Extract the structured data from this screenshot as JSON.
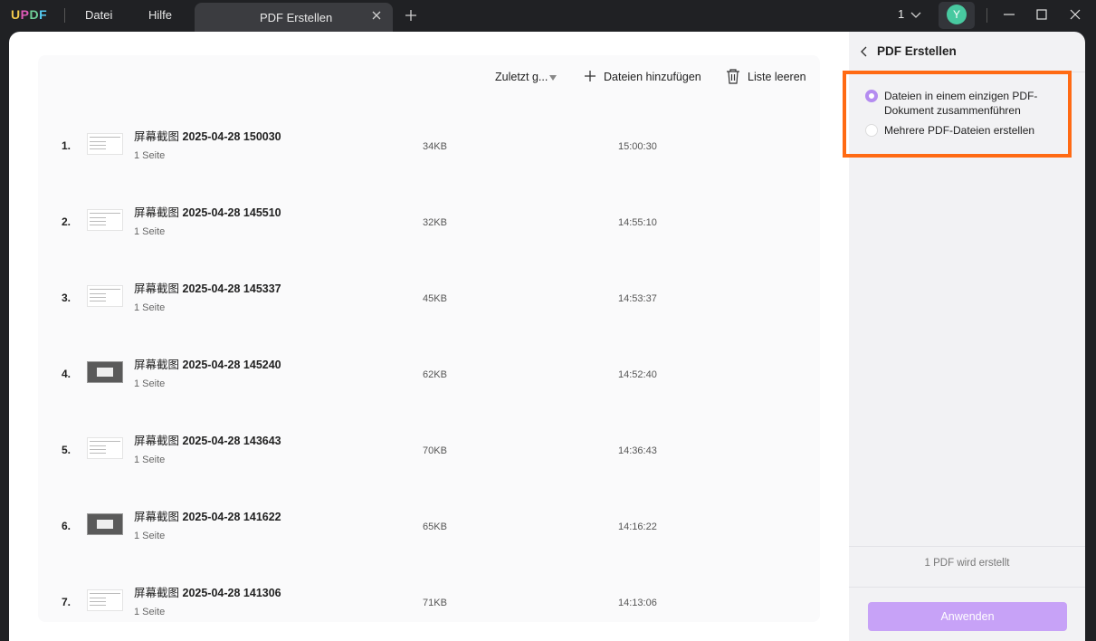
{
  "app": {
    "logo": "UPDF",
    "menu": [
      "Datei",
      "Hilfe"
    ],
    "tab_title": "PDF Erstellen",
    "page_indicator": "1",
    "avatar_initial": "Y"
  },
  "toolbar": {
    "sort_label": "Zuletzt g...",
    "add_files_label": "Dateien hinzufügen",
    "clear_list_label": "Liste leeren"
  },
  "files": [
    {
      "index": "1.",
      "name_prefix": "屏幕截图",
      "name_date": "2025-04-28 150030",
      "pages": "1 Seite",
      "size": "34KB",
      "time": "15:00:30",
      "thumb": "light"
    },
    {
      "index": "2.",
      "name_prefix": "屏幕截图",
      "name_date": "2025-04-28 145510",
      "pages": "1 Seite",
      "size": "32KB",
      "time": "14:55:10",
      "thumb": "light"
    },
    {
      "index": "3.",
      "name_prefix": "屏幕截图",
      "name_date": "2025-04-28 145337",
      "pages": "1 Seite",
      "size": "45KB",
      "time": "14:53:37",
      "thumb": "light"
    },
    {
      "index": "4.",
      "name_prefix": "屏幕截图",
      "name_date": "2025-04-28 145240",
      "pages": "1 Seite",
      "size": "62KB",
      "time": "14:52:40",
      "thumb": "dark"
    },
    {
      "index": "5.",
      "name_prefix": "屏幕截图",
      "name_date": "2025-04-28 143643",
      "pages": "1 Seite",
      "size": "70KB",
      "time": "14:36:43",
      "thumb": "light"
    },
    {
      "index": "6.",
      "name_prefix": "屏幕截图",
      "name_date": "2025-04-28 141622",
      "pages": "1 Seite",
      "size": "65KB",
      "time": "14:16:22",
      "thumb": "dark"
    },
    {
      "index": "7.",
      "name_prefix": "屏幕截图",
      "name_date": "2025-04-28 141306",
      "pages": "1 Seite",
      "size": "71KB",
      "time": "14:13:06",
      "thumb": "light"
    }
  ],
  "panel": {
    "title": "PDF Erstellen",
    "options": [
      {
        "label": "Dateien in einem einzigen PDF-Dokument zusammenführen",
        "checked": true
      },
      {
        "label": "Mehrere PDF-Dateien erstellen",
        "checked": false
      }
    ],
    "status": "1 PDF wird erstellt",
    "apply_label": "Anwenden"
  },
  "colors": {
    "accent": "#c7a2f7",
    "radio_checked": "#b48cf0",
    "highlight": "#ff6a13",
    "titlebar": "#202124"
  }
}
